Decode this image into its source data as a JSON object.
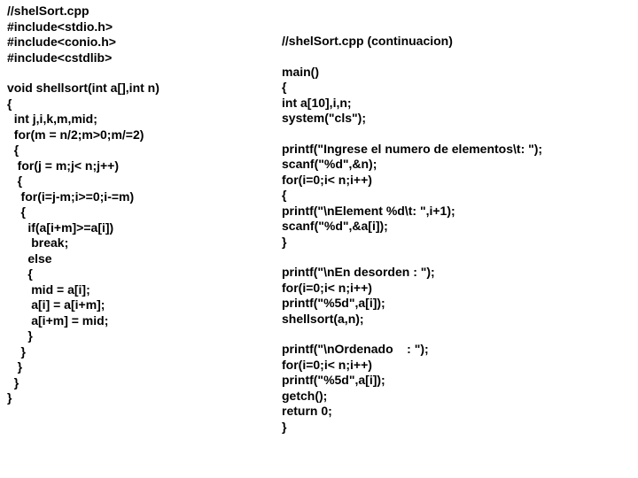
{
  "left": {
    "l0": "//shelSort.cpp",
    "l1": "#include<stdio.h>",
    "l2": "#include<conio.h>",
    "l3": "#include<cstdlib>",
    "l4": "",
    "l5": "void shellsort(int a[],int n)",
    "l6": "{",
    "l7": "  int j,i,k,m,mid;",
    "l8": "  for(m = n/2;m>0;m/=2)",
    "l9": "  {",
    "l10": "   for(j = m;j< n;j++)",
    "l11": "   {",
    "l12": "    for(i=j-m;i>=0;i-=m)",
    "l13": "    {",
    "l14": "      if(a[i+m]>=a[i])",
    "l15": "       break;",
    "l16": "      else",
    "l17": "      {",
    "l18": "       mid = a[i];",
    "l19": "       a[i] = a[i+m];",
    "l20": "       a[i+m] = mid;",
    "l21": "      }",
    "l22": "    }",
    "l23": "   }",
    "l24": "  }",
    "l25": "}"
  },
  "right": {
    "r0": "",
    "r1": "",
    "r2": "//shelSort.cpp (continuacion)",
    "r3": "",
    "r4": "main()",
    "r5": "{",
    "r6": "int a[10],i,n;",
    "r7": "system(\"cls\");",
    "r8": "",
    "r9": "printf(\"Ingrese el numero de elementos\\t: \");",
    "r10": "scanf(\"%d\",&n);",
    "r11": "for(i=0;i< n;i++)",
    "r12": "{",
    "r13": "printf(\"\\nElement %d\\t: \",i+1);",
    "r14": "scanf(\"%d\",&a[i]);",
    "r15": "}",
    "r16": "",
    "r17": "printf(\"\\nEn desorden : \");",
    "r18": "for(i=0;i< n;i++)",
    "r19": "printf(\"%5d\",a[i]);",
    "r20": "shellsort(a,n);",
    "r21": "",
    "r22": "printf(\"\\nOrdenado    : \");",
    "r23": "for(i=0;i< n;i++)",
    "r24": "printf(\"%5d\",a[i]);",
    "r25": "getch();",
    "r26": "return 0;",
    "r27": "}"
  }
}
